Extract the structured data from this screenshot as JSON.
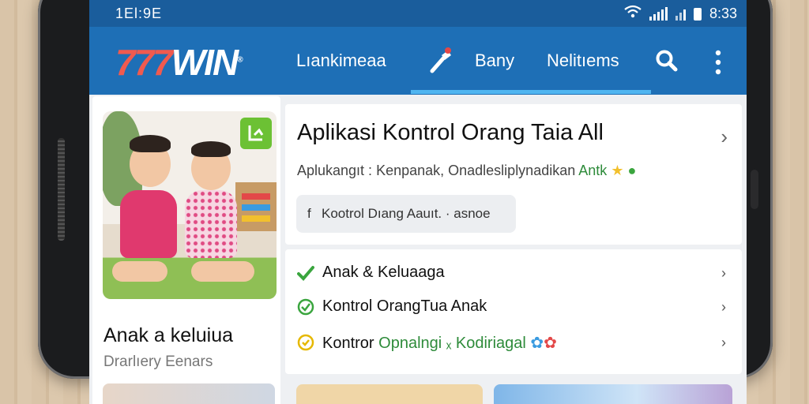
{
  "status_bar": {
    "time": "1El:9E",
    "clock": "8:33"
  },
  "app_bar": {
    "logo_numbers": "777",
    "logo_text": "WIN",
    "nav_items": [
      "Lıankimeaa",
      "Bany",
      "Nelitıems"
    ]
  },
  "left_card": {
    "title": "Anak a keluiua",
    "subtitle": "Drarlıery Eenars"
  },
  "header_card": {
    "title": "Aplikasi Kontrol Orang Taia All",
    "subtitle_plain": "Aplukangıt : Kenpanak, Onadlesliplynadikan",
    "subtitle_green": "Antk",
    "chip_icon": "f",
    "chip_label": "Kootrol Dıang Aauıt. · asnoe"
  },
  "list_items": [
    {
      "label": "Anak & Keluaaga",
      "icon": "check-pencil-icon",
      "color": "#3aa53e"
    },
    {
      "label": "Kontrol OrangTua Anak",
      "icon": "check-circle-icon",
      "color": "#3aa53e"
    },
    {
      "label_plain": "Kontror",
      "label_green": "Opnalngi ₓ Kodiriagal",
      "icon": "warning-circle-icon",
      "color": "#e6b800"
    }
  ],
  "colors": {
    "primary": "#1e6fb6",
    "status": "#1a5d9c",
    "accent_green": "#3aa53e",
    "logo_red": "#f05a4f"
  }
}
